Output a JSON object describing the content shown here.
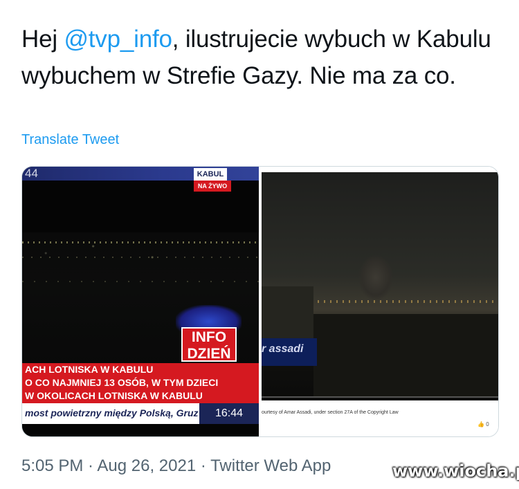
{
  "tweet": {
    "text_prefix": "Hej ",
    "mention": "@tvp_info",
    "text_suffix": ", ilustrujecie wybuch w Kabulu wybuchem w Strefie Gazy. Nie ma za co.",
    "translate_label": "Translate Tweet",
    "meta": "5:05 PM · Aug 26, 2021 · Twitter Web App"
  },
  "left_image": {
    "top_clock": "44",
    "location_label": "KABUL",
    "live_label": "NA ŻYWO",
    "logo_line1": "INFO",
    "logo_line2": "DZIEŃ",
    "ticker_lines": [
      "ACH LOTNISKA W KABULU",
      "O CO NAJMNIEJ 13 OSÓB, W TYM DZIECI",
      "W OKOLICACH LOTNISKA W KABULU"
    ],
    "bottom_ticker": "most powietrzny między Polską, Gruz",
    "clock": "16:44"
  },
  "right_image": {
    "watermark": "r assadi",
    "caption": "ourtesy of Amar Assadi, under section 27A of the Copyright Law",
    "likes": "0"
  },
  "watermark_site": "www.wiocha.pl",
  "colors": {
    "accent": "#1d9bf0",
    "tvp_red": "#d51920",
    "tvp_navy": "#1b2557"
  }
}
